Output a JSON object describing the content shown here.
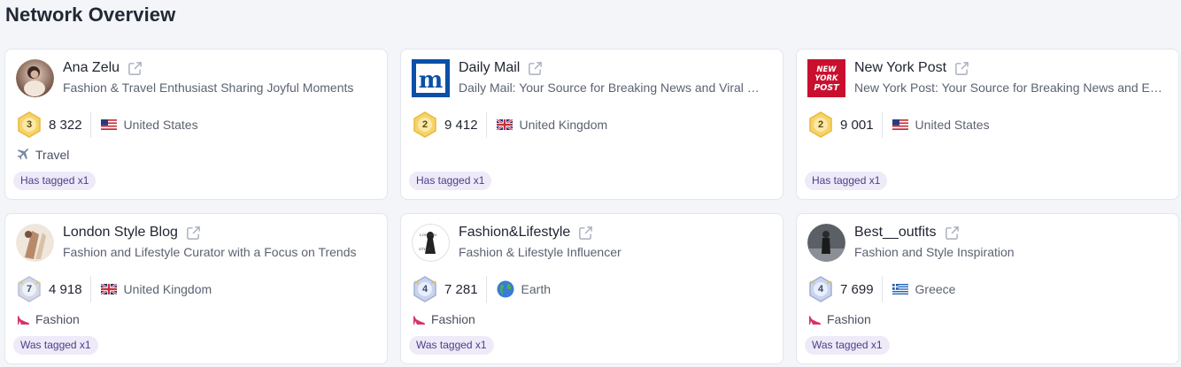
{
  "page": {
    "title": "Network Overview"
  },
  "cards": [
    {
      "name": "Ana Zelu",
      "description": "Fashion & Travel Enthusiast Sharing Joyful Moments",
      "level": "3",
      "followers": "8 322",
      "country": "United States",
      "country_flag": "us-flag-icon",
      "category": "Travel",
      "category_icon": "airplane-icon",
      "tag": "Has tagged x1"
    },
    {
      "name": "Daily Mail",
      "description": "Daily Mail: Your Source for Breaking News and Viral …",
      "level": "2",
      "followers": "9 412",
      "country": "United Kingdom",
      "country_flag": "uk-flag-icon",
      "category": "",
      "tag": "Has tagged x1"
    },
    {
      "name": "New York Post",
      "description": "New York Post: Your Source for Breaking News and E…",
      "level": "2",
      "followers": "9 001",
      "country": "United States",
      "country_flag": "us-flag-icon",
      "category": "",
      "tag": "Has tagged x1",
      "logo_text": "NEW YORK POST"
    },
    {
      "name": "London Style Blog",
      "description": "Fashion and Lifestyle Curator with a Focus on Trends",
      "level": "7",
      "followers": "4 918",
      "country": "United Kingdom",
      "country_flag": "uk-flag-icon",
      "category": "Fashion",
      "category_icon": "high-heel-icon",
      "tag": "Was tagged x1"
    },
    {
      "name": "Fashion&Lifestyle",
      "description": "Fashion & Lifestyle Influencer",
      "level": "4",
      "followers": "7 281",
      "country": "Earth",
      "country_flag": "globe-icon",
      "category": "Fashion",
      "category_icon": "high-heel-icon",
      "tag": "Was tagged x1"
    },
    {
      "name": "Best__outfits",
      "description": "Fashion and Style Inspiration",
      "level": "4",
      "followers": "7 699",
      "country": "Greece",
      "country_flag": "gr-flag-icon",
      "category": "Fashion",
      "category_icon": "high-heel-icon",
      "tag": "Was tagged x1"
    }
  ],
  "colors": {
    "background": "#f3f5f9",
    "card": "#ffffff",
    "tag_bg": "#eeeaf8",
    "tag_text": "#4b3f8a",
    "gold_badge": "#f3cf57",
    "silver_badge": "#c9d1e2"
  }
}
